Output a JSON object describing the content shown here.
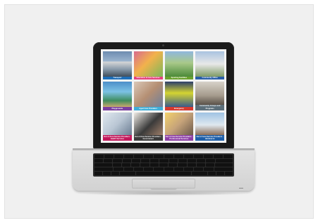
{
  "tiles": [
    {
      "label": "Transport",
      "color": "#1f6fb8"
    },
    {
      "label": "Education & Care Services",
      "color": "#e4427c"
    },
    {
      "label": "Sporting Facilities",
      "color": "#6aa12d"
    },
    {
      "label": "Community Office",
      "color": "#2a5fa8"
    },
    {
      "label": "Playgrounds",
      "color": "#7a3fa0"
    },
    {
      "label": "Aged Care Providers",
      "color": "#3faed8"
    },
    {
      "label": "Emergency",
      "color": "#d63a2f"
    },
    {
      "label": "Community Groups and Programs",
      "color": "#5c6f7a"
    },
    {
      "label": "Out of Area Service Providers - Health Services",
      "color": "#c2185b"
    },
    {
      "label": "Out of Area Service Providers - Government",
      "color": "#3b3b3b"
    },
    {
      "label": "Out of Area Service Providers - Professional Services",
      "color": "#8d3fa6"
    },
    {
      "label": "Out of Area Service Providers - Hindmarsh",
      "color": "#1f5fa8"
    }
  ]
}
